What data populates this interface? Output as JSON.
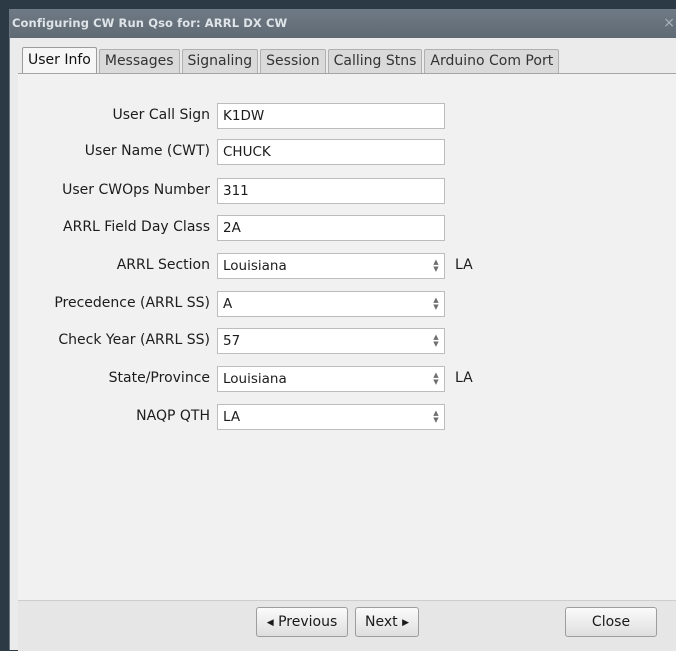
{
  "window": {
    "title": "Configuring CW Run Qso for: ARRL DX CW",
    "close_glyph": "×"
  },
  "tabs": [
    {
      "label": "User Info",
      "active": true
    },
    {
      "label": "Messages",
      "active": false
    },
    {
      "label": "Signaling",
      "active": false
    },
    {
      "label": "Session",
      "active": false
    },
    {
      "label": "Calling Stns",
      "active": false
    },
    {
      "label": "Arduino Com Port",
      "active": false
    }
  ],
  "form": {
    "call_sign": {
      "label": "User Call Sign",
      "value": "K1DW"
    },
    "user_name": {
      "label": "User Name (CWT)",
      "value": "CHUCK"
    },
    "cwops_number": {
      "label": "User CWOps Number",
      "value": "311"
    },
    "field_day_class": {
      "label": "ARRL Field Day Class",
      "value": "2A"
    },
    "arrl_section": {
      "label": "ARRL Section",
      "value": "Louisiana",
      "abbr": "LA"
    },
    "precedence": {
      "label": "Precedence (ARRL SS)",
      "value": "A"
    },
    "check_year": {
      "label": "Check Year (ARRL SS)",
      "value": "57"
    },
    "state_province": {
      "label": "State/Province",
      "value": "Louisiana",
      "abbr": "LA"
    },
    "naqp_qth": {
      "label": "NAQP QTH",
      "value": "LA"
    }
  },
  "footer": {
    "previous_label": "Previous",
    "previous_arrow": "◀",
    "next_label": "Next",
    "next_arrow": "▶",
    "close_label": "Close"
  }
}
